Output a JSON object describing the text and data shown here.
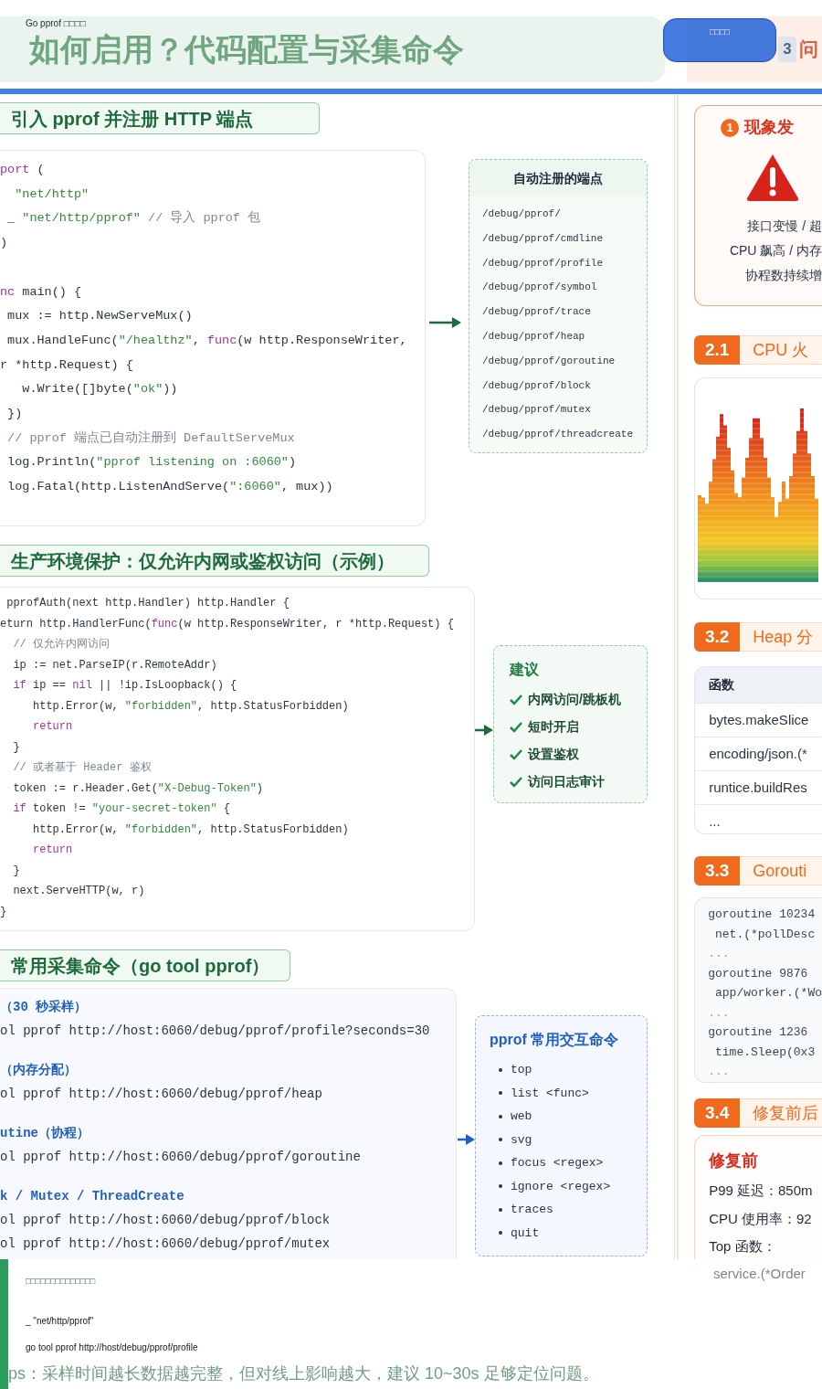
{
  "header": {
    "caption": "Go pprof □□□□",
    "banner_title": "如何启用？代码配置与采集命令",
    "next_banner": {
      "number": "3",
      "title": "问"
    },
    "button": "□□□□"
  },
  "import_section": {
    "heading": "引入 pprof 并注册 HTTP 端点",
    "code": [
      {
        "tokens": [
          {
            "kind": "kw",
            "text": "port"
          },
          {
            "kind": "txt",
            "text": " ("
          }
        ]
      },
      {
        "tokens": [
          {
            "kind": "str",
            "text": "  \"net/http\""
          }
        ]
      },
      {
        "tokens": [
          {
            "kind": "txt",
            "text": " _ "
          },
          {
            "kind": "str",
            "text": "\"net/http/pprof\""
          },
          {
            "kind": "cmt",
            "text": " // 导入 pprof 包"
          }
        ]
      },
      {
        "tokens": [
          {
            "kind": "txt",
            "text": ")"
          }
        ]
      },
      {
        "kind": "blank"
      },
      {
        "tokens": [
          {
            "kind": "kw",
            "text": "nc"
          },
          {
            "kind": "txt",
            "text": " main() {"
          }
        ]
      },
      {
        "tokens": [
          {
            "kind": "txt",
            "text": " mux := http.NewServeMux()"
          }
        ]
      },
      {
        "tokens": [
          {
            "kind": "txt",
            "text": " mux.HandleFunc("
          },
          {
            "kind": "str",
            "text": "\"/healthz\""
          },
          {
            "kind": "txt",
            "text": ", "
          },
          {
            "kind": "kw",
            "text": "func"
          },
          {
            "kind": "txt",
            "text": "(w http.ResponseWriter,"
          }
        ]
      },
      {
        "tokens": [
          {
            "kind": "txt",
            "text": "r *http.Request) {"
          }
        ]
      },
      {
        "tokens": [
          {
            "kind": "txt",
            "text": "   w.Write([]byte("
          },
          {
            "kind": "str",
            "text": "\"ok\""
          },
          {
            "kind": "txt",
            "text": "))"
          }
        ]
      },
      {
        "tokens": [
          {
            "kind": "txt",
            "text": " })"
          }
        ]
      },
      {
        "tokens": [
          {
            "kind": "cmt",
            "text": " // pprof 端点已自动注册到 DefaultServeMux"
          }
        ]
      },
      {
        "tokens": [
          {
            "kind": "txt",
            "text": " log.Println("
          },
          {
            "kind": "str",
            "text": "\"pprof listening on :6060\""
          },
          {
            "kind": "txt",
            "text": ")"
          }
        ]
      },
      {
        "tokens": [
          {
            "kind": "txt",
            "text": " log.Fatal(http.ListenAndServe("
          },
          {
            "kind": "str",
            "text": "\":6060\""
          },
          {
            "kind": "txt",
            "text": ", mux))"
          }
        ]
      }
    ],
    "endpoints": {
      "title": "自动注册的端点",
      "paths": [
        "/debug/pprof/",
        "/debug/pprof/cmdline",
        "/debug/pprof/profile",
        "/debug/pprof/symbol",
        "/debug/pprof/trace",
        "/debug/pprof/heap",
        "/debug/pprof/goroutine",
        "/debug/pprof/block",
        "/debug/pprof/mutex",
        "/debug/pprof/threadcreate"
      ]
    }
  },
  "auth_section": {
    "heading": "生产环境保护：仅允许内网或鉴权访问（示例）",
    "code": [
      {
        "tokens": [
          {
            "kind": "txt",
            "text": " pprofAuth(next http.Handler) http.Handler {"
          }
        ]
      },
      {
        "tokens": [
          {
            "kind": "txt",
            "text": "eturn http.HandlerFunc("
          },
          {
            "kind": "kw",
            "text": "func"
          },
          {
            "kind": "txt",
            "text": "(w http.ResponseWriter, r *http.Request) {"
          }
        ]
      },
      {
        "tokens": [
          {
            "kind": "cmt",
            "text": "  // 仅允许内网访问"
          }
        ]
      },
      {
        "tokens": [
          {
            "kind": "txt",
            "text": "  ip := net.ParseIP(r.RemoteAddr)"
          }
        ]
      },
      {
        "tokens": [
          {
            "kind": "kw",
            "text": "  if"
          },
          {
            "kind": "txt",
            "text": " ip == "
          },
          {
            "kind": "kw",
            "text": "nil"
          },
          {
            "kind": "txt",
            "text": " || !ip.IsLoopback() {"
          }
        ]
      },
      {
        "tokens": [
          {
            "kind": "txt",
            "text": "     http.Error(w, "
          },
          {
            "kind": "str",
            "text": "\"forbidden\""
          },
          {
            "kind": "txt",
            "text": ", http.StatusForbidden)"
          }
        ]
      },
      {
        "tokens": [
          {
            "kind": "kw",
            "text": "     return"
          }
        ]
      },
      {
        "tokens": [
          {
            "kind": "txt",
            "text": "  }"
          }
        ]
      },
      {
        "tokens": [
          {
            "kind": "cmt",
            "text": "  // 或者基于 Header 鉴权"
          }
        ]
      },
      {
        "tokens": [
          {
            "kind": "txt",
            "text": "  token := r.Header.Get("
          },
          {
            "kind": "str",
            "text": "\"X-Debug-Token\""
          },
          {
            "kind": "txt",
            "text": ")"
          }
        ]
      },
      {
        "tokens": [
          {
            "kind": "kw",
            "text": "  if"
          },
          {
            "kind": "txt",
            "text": " token != "
          },
          {
            "kind": "str",
            "text": "\"your-secret-token\""
          },
          {
            "kind": "txt",
            "text": " {"
          }
        ]
      },
      {
        "tokens": [
          {
            "kind": "txt",
            "text": "     http.Error(w, "
          },
          {
            "kind": "str",
            "text": "\"forbidden\""
          },
          {
            "kind": "txt",
            "text": ", http.StatusForbidden)"
          }
        ]
      },
      {
        "tokens": [
          {
            "kind": "kw",
            "text": "     return"
          }
        ]
      },
      {
        "tokens": [
          {
            "kind": "txt",
            "text": "  }"
          }
        ]
      },
      {
        "tokens": [
          {
            "kind": "txt",
            "text": "  next.ServeHTTP(w, r)"
          }
        ]
      },
      {
        "tokens": [
          {
            "kind": "txt",
            "text": "}"
          }
        ]
      }
    ],
    "advice": {
      "title": "建议",
      "items": [
        "内网访问/跳板机",
        "短时开启",
        "设置鉴权",
        "访问日志审计"
      ]
    }
  },
  "commands_section": {
    "heading": "常用采集命令（go tool pprof）",
    "groups": [
      {
        "title": "（30 秒采样）",
        "commands": [
          "ol pprof http://host:6060/debug/pprof/profile?seconds=30"
        ]
      },
      {
        "title": "（内存分配）",
        "commands": [
          "ol pprof http://host:6060/debug/pprof/heap"
        ]
      },
      {
        "title": "utine（协程）",
        "commands": [
          "ol pprof http://host:6060/debug/pprof/goroutine"
        ]
      },
      {
        "title": "k / Mutex / ThreadCreate",
        "commands": [
          "ol pprof http://host:6060/debug/pprof/block",
          "ol pprof http://host:6060/debug/pprof/mutex"
        ]
      }
    ],
    "interactive": {
      "title": "pprof 常用交互命令",
      "items": [
        "top",
        "list <func>",
        "web",
        "svg",
        "focus <regex>",
        "ignore <regex>",
        "traces",
        "quit"
      ]
    }
  },
  "problem_card": {
    "number": "1",
    "title": "现象发",
    "lines": [
      "接口变慢 / 超",
      "CPU 飙高 / 内存",
      "协程数持续增"
    ]
  },
  "cpu_section": {
    "number": "2.1",
    "title": "CPU 火"
  },
  "heap_section": {
    "number": "3.2",
    "title": "Heap 分",
    "column": "函数",
    "rows": [
      "bytes.makeSlice",
      "encoding/json.(*",
      "runtice.buildRes",
      "..."
    ]
  },
  "goroutine_section": {
    "number": "3.3",
    "title": "Gorouti",
    "lines": [
      {
        "kind": "head",
        "text": "goroutine 10234"
      },
      {
        "kind": "frame",
        "text": " net.(*pollDesc"
      },
      {
        "kind": "more",
        "text": "..."
      },
      {
        "kind": "head",
        "text": "goroutine 9876"
      },
      {
        "kind": "frame",
        "text": " app/worker.(*Wo"
      },
      {
        "kind": "more",
        "text": "..."
      },
      {
        "kind": "head",
        "text": "goroutine 1236"
      },
      {
        "kind": "frame",
        "text": " time.Sleep(0x3"
      },
      {
        "kind": "more",
        "text": "..."
      }
    ]
  },
  "fix_section": {
    "number": "3.4",
    "title": "修复前后",
    "before_title": "修复前",
    "lines": [
      "P99 延迟：850m",
      "CPU 使用率：92",
      "Top 函数："
    ],
    "faded_line": "service.(*Order"
  },
  "notice": {
    "title": "□□□□□□□□□□□□□□",
    "lines": [
      "_ \"net/http/pprof\"",
      "go tool pprof http://host/debug/pprof/profile"
    ]
  },
  "tips": "ps：采样时间越长数据越完整，但对线上影响越大，建议 10~30s 足够定位问题。"
}
